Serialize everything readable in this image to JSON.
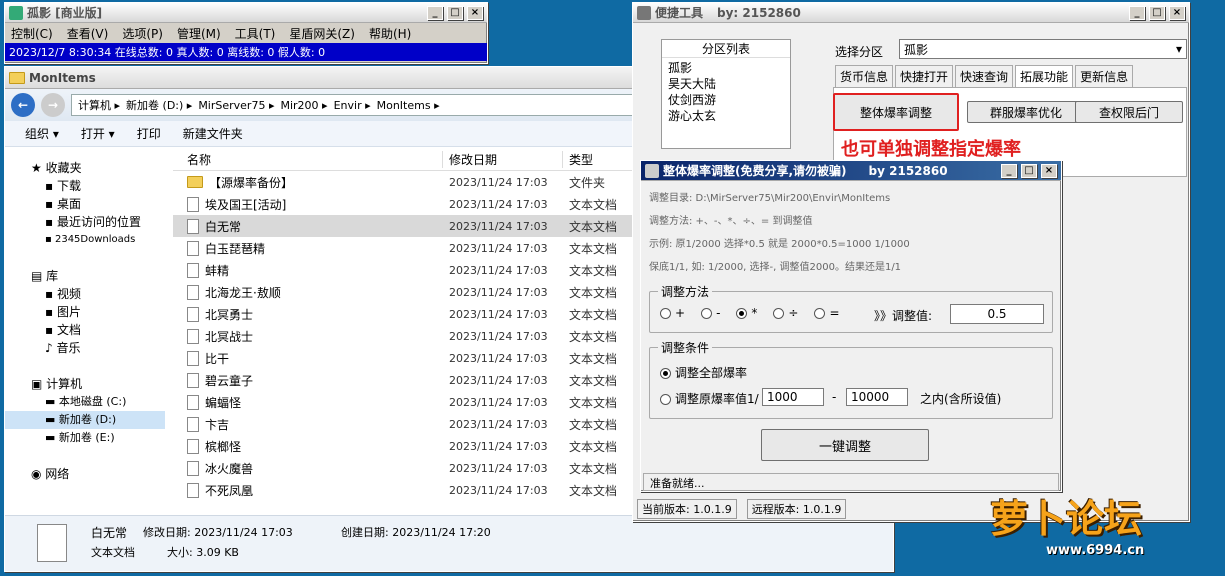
{
  "desktop_bg": "#0f6aa3",
  "game_window": {
    "title": "孤影 [商业版]",
    "menu": [
      "控制(C)",
      "查看(V)",
      "选项(P)",
      "管理(M)",
      "工具(T)",
      "星盾网关(Z)",
      "帮助(H)"
    ],
    "log_line": "2023/12/7 8:30:34 在线总数: 0 真人数: 0 离线数: 0 假人数: 0",
    "log_line2": "2023/12/7 8:30:34 在线总数: 0 真人数: 0 离线数: 0 假人数: 0"
  },
  "explorer": {
    "title": "MonItems",
    "address": [
      "计算机",
      "新加卷 (D:)",
      "MirServer75",
      "Mir200",
      "Envir",
      "MonItems"
    ],
    "toolbar": {
      "organize": "组织 ▾",
      "open": "打开 ▾",
      "print": "打印",
      "new_folder": "新建文件夹"
    },
    "nav": {
      "favorites": "收藏夹",
      "download": "下载",
      "desktop": "桌面",
      "recent": "最近访问的位置",
      "dl2345": "2345Downloads",
      "library": "库",
      "video": "视频",
      "pictures": "图片",
      "docs": "文档",
      "music": "音乐",
      "computer": "计算机",
      "local_c": "本地磁盘 (C:)",
      "new_d": "新加卷 (D:)",
      "new_e": "新加卷 (E:)",
      "network": "网络"
    },
    "columns": {
      "name": "名称",
      "date": "修改日期",
      "type": "类型"
    },
    "files": [
      {
        "name": "【源爆率备份】",
        "date": "2023/11/24 17:03",
        "type": "文件夹",
        "folder": true
      },
      {
        "name": "埃及国王[活动]",
        "date": "2023/11/24 17:03",
        "type": "文本文档"
      },
      {
        "name": "白无常",
        "date": "2023/11/24 17:03",
        "type": "文本文档",
        "selected": true
      },
      {
        "name": "白玉琵琶精",
        "date": "2023/11/24 17:03",
        "type": "文本文档"
      },
      {
        "name": "蚌精",
        "date": "2023/11/24 17:03",
        "type": "文本文档"
      },
      {
        "name": "北海龙王·敖顺",
        "date": "2023/11/24 17:03",
        "type": "文本文档"
      },
      {
        "name": "北冥勇士",
        "date": "2023/11/24 17:03",
        "type": "文本文档"
      },
      {
        "name": "北冥战士",
        "date": "2023/11/24 17:03",
        "type": "文本文档"
      },
      {
        "name": "比干",
        "date": "2023/11/24 17:03",
        "type": "文本文档"
      },
      {
        "name": "碧云童子",
        "date": "2023/11/24 17:03",
        "type": "文本文档"
      },
      {
        "name": "蝙蝠怪",
        "date": "2023/11/24 17:03",
        "type": "文本文档"
      },
      {
        "name": "卞吉",
        "date": "2023/11/24 17:03",
        "type": "文本文档"
      },
      {
        "name": "槟榔怪",
        "date": "2023/11/24 17:03",
        "type": "文本文档"
      },
      {
        "name": "冰火魔兽",
        "date": "2023/11/24 17:03",
        "type": "文本文档"
      },
      {
        "name": "不死凤凰",
        "date": "2023/11/24 17:03",
        "type": "文本文档"
      }
    ],
    "details": {
      "name": "白无常",
      "modified_label": "修改日期: 2023/11/24 17:03",
      "created_label": "创建日期: 2023/11/24 17:20",
      "type": "文本文档",
      "size": "大小: 3.09 KB"
    }
  },
  "tool": {
    "title": "便捷工具",
    "by": "by: 2152860",
    "region_header": "分区列表",
    "regions": [
      "孤影",
      "昊天大陆",
      "仗剑西游",
      "游心太玄"
    ],
    "select_label": "选择分区",
    "select_value": "孤影",
    "tabs": [
      "货币信息",
      "快捷打开",
      "快速查询",
      "拓展功能",
      "更新信息"
    ],
    "btn_adjust": "整体爆率调整",
    "btn_group": "群服爆率优化",
    "btn_backdoor": "查权限后门",
    "annotation": "也可单独调整指定爆率",
    "version": "当前版本: 1.0.1.9",
    "remote_version": "远程版本: 1.0.1.9"
  },
  "dialog": {
    "title": "整体爆率调整(免费分享,请勿被骗)",
    "by": "by 2152860",
    "dir": "调整目录: D:\\MirServer75\\Mir200\\Envir\\MonItems",
    "method_line": "调整方法: +、-、*、÷、=  到调整值",
    "example": "示例: 原1/2000 选择*0.5 就是 2000*0.5=1000  1/1000",
    "floor": "保底1/1, 如: 1/2000, 选择-, 调整值2000。结果还是1/1",
    "method_group": "调整方法",
    "ops": [
      "+",
      "-",
      "*",
      "÷",
      "="
    ],
    "selected_op": "*",
    "value_label": "》》调整值:",
    "value": "0.5",
    "cond_group": "调整条件",
    "cond_all": "调整全部爆率",
    "cond_range": "调整原爆率值1/",
    "range_from": "1000",
    "dash": "-",
    "range_to": "10000",
    "range_suffix": "之内(含所设值)",
    "apply": "一键调整",
    "status": "准备就绪..."
  },
  "logo": {
    "brand": "萝卜论坛",
    "url": "www.6994.cn"
  }
}
